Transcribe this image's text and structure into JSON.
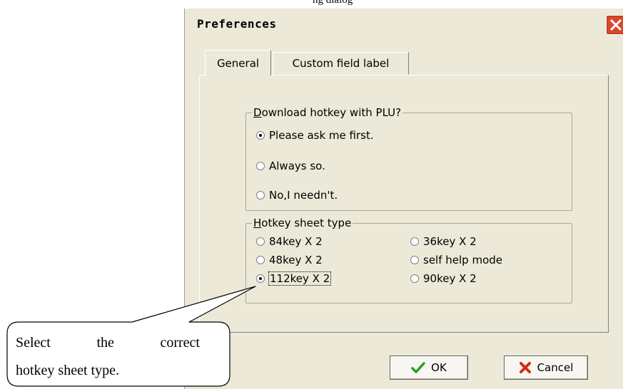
{
  "top_caption": "ng dialog",
  "window": {
    "title": "Preferences"
  },
  "tabs": [
    {
      "label": "General",
      "active": true
    },
    {
      "label": "Custom field label",
      "active": false
    }
  ],
  "download_group": {
    "legend_underline": "D",
    "legend_rest": "ownload hotkey with PLU?",
    "options": [
      {
        "label": "Please ask me first.",
        "checked": true
      },
      {
        "label": "Always so.",
        "checked": false
      },
      {
        "label": "No,I needn't.",
        "checked": false
      }
    ]
  },
  "hotkey_group": {
    "legend_underline": "H",
    "legend_rest": "otkey sheet type",
    "options": [
      {
        "label": "84key X 2",
        "checked": false
      },
      {
        "label": "36key X 2",
        "checked": false
      },
      {
        "label": "48key X 2",
        "checked": false
      },
      {
        "label": "self help mode",
        "checked": false
      },
      {
        "label": "112key X 2",
        "checked": true
      },
      {
        "label": "90key X 2",
        "checked": false
      }
    ]
  },
  "buttons": {
    "ok": "OK",
    "cancel": "Cancel"
  },
  "callout": {
    "line1_words": [
      "Select",
      "the",
      "correct"
    ],
    "line2": "hotkey sheet type."
  },
  "colors": {
    "check_green": "#2e9b2e",
    "cancel_red": "#d42a1a",
    "close_red": "#d9482b"
  }
}
